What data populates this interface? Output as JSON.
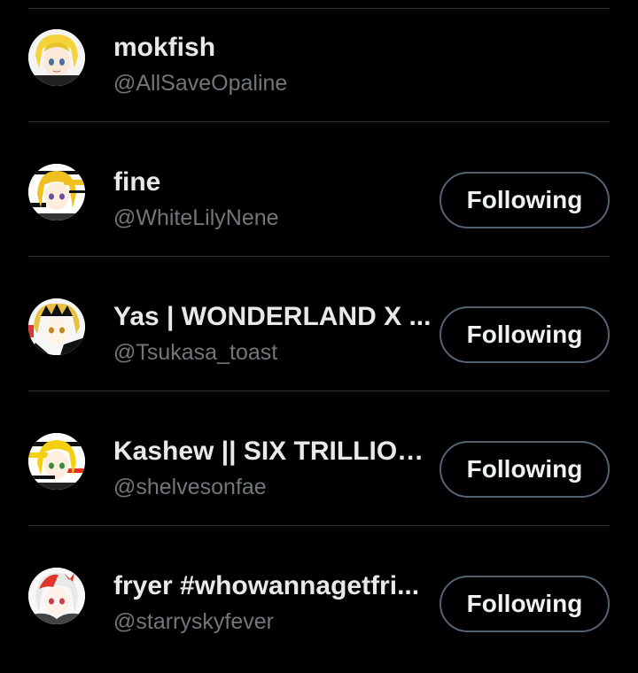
{
  "users": [
    {
      "name": "mokfish",
      "handle": "@AllSaveOpaline",
      "follow_label": "",
      "avatar_icon": "profile-avatar-anime-blonde",
      "avatar_hair": "#f3d23a"
    },
    {
      "name": "fine",
      "handle": "@WhiteLilyNene",
      "follow_label": "Following",
      "avatar_icon": "profile-avatar-anime-glitch",
      "avatar_hair": "#f0c020"
    },
    {
      "name": "Yas | WONDERLAND X ...",
      "handle": "@Tsukasa_toast",
      "follow_label": "Following",
      "avatar_icon": "profile-avatar-anime-bw",
      "avatar_hair": "#e9c040"
    },
    {
      "name": "Kashew || SIX TRILLION ...",
      "handle": "@shelvesonfae",
      "follow_label": "Following",
      "avatar_icon": "profile-avatar-anime-glitch",
      "avatar_hair": "#f5d010"
    },
    {
      "name": "fryer #whowannagetfri...",
      "handle": "@starryskyfever",
      "follow_label": "Following",
      "avatar_icon": "profile-avatar-anime-red",
      "avatar_hair": "#e0352b"
    }
  ],
  "colors": {
    "background": "#000000",
    "primary_text": "#e7e9ea",
    "secondary_text": "#71767b",
    "divider": "#2f3336",
    "button_border": "#536471"
  }
}
